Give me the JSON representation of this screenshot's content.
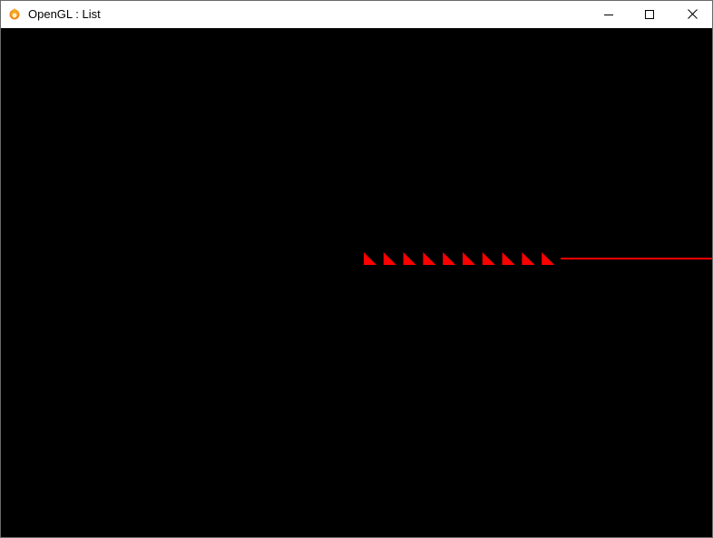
{
  "window": {
    "title": "OpenGL : List",
    "icon": "flame-app-icon",
    "controls": [
      "minimize",
      "maximize",
      "close"
    ]
  },
  "scene": {
    "background": "#000000",
    "shape_color": "#ff0000",
    "triangle_count": 10,
    "has_line": true
  }
}
